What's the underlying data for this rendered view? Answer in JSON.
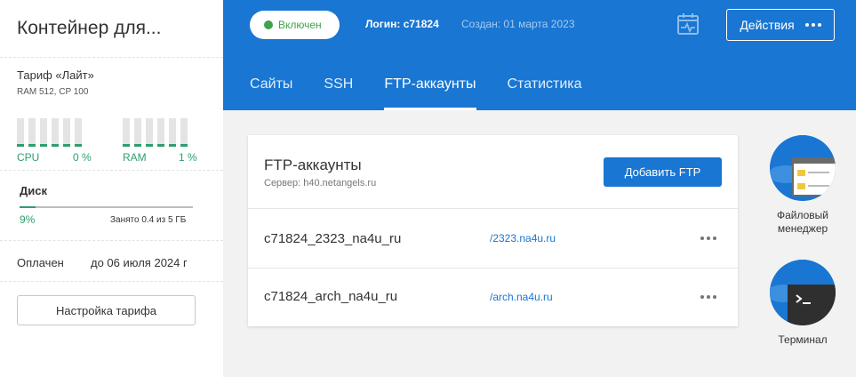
{
  "sidebar": {
    "title": "Контейнер для...",
    "tariff": {
      "name": "Тариф «Лайт»",
      "spec": "RAM 512, CP 100"
    },
    "cpu": {
      "label": "CPU",
      "value": "0 %"
    },
    "ram": {
      "label": "RAM",
      "value": "1 %"
    },
    "disk": {
      "title": "Диск",
      "percent_label": "9%",
      "fill_fraction": 0.09,
      "used": "Занято 0.4 из 5 ГБ"
    },
    "paid": {
      "label": "Оплачен",
      "until": "до 06 июля 2024 г"
    },
    "plan_button": "Настройка тарифа"
  },
  "header": {
    "status": "Включен",
    "login": "Логин: c71824",
    "created": "Создан: 01 марта 2023",
    "actions": "Действия",
    "tabs": [
      {
        "label": "Сайты"
      },
      {
        "label": "SSH"
      },
      {
        "label": "FTP-аккаунты"
      },
      {
        "label": "Статистика"
      }
    ]
  },
  "ftp": {
    "title": "FTP-аккаунты",
    "server": "Сервер: h40.netangels.ru",
    "add_button": "Добавить FTP",
    "accounts": [
      {
        "name": "c71824_2323_na4u_ru",
        "path": "/2323.na4u.ru"
      },
      {
        "name": "c71824_arch_na4u_ru",
        "path": "/arch.na4u.ru"
      }
    ]
  },
  "tools": {
    "file_manager": {
      "line1": "Файловый",
      "line2": "менеджер",
      "icon": "file-manager-icon"
    },
    "terminal": {
      "label": "Терминал",
      "icon": "terminal-icon"
    }
  },
  "colors": {
    "brand": "#1976d2",
    "success": "#2e9e6e",
    "status_green": "#3fa34d"
  }
}
